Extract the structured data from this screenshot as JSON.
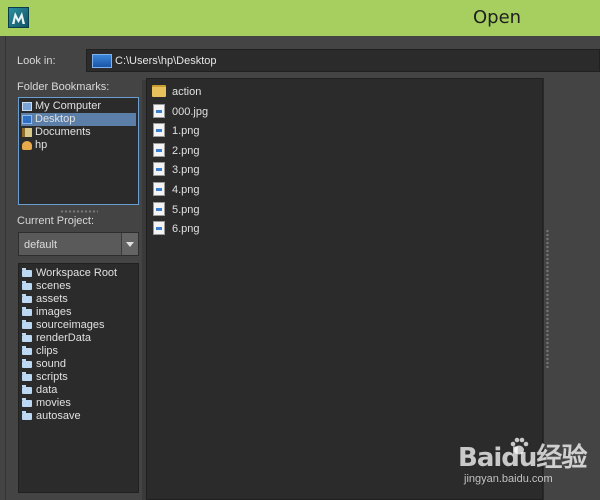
{
  "window": {
    "title": "Open",
    "titlebar_color": "#a6cf5f"
  },
  "look_in": {
    "label": "Look in:",
    "value": "C:\\Users\\hp\\Desktop",
    "icon": "desktop-icon"
  },
  "bookmarks": {
    "label": "Folder Bookmarks:",
    "items": [
      {
        "label": "My Computer",
        "icon": "computer-icon"
      },
      {
        "label": "Desktop",
        "icon": "desktop-icon",
        "selected": true
      },
      {
        "label": "Documents",
        "icon": "documents-icon"
      },
      {
        "label": "hp",
        "icon": "user-icon"
      }
    ]
  },
  "project": {
    "label": "Current Project:",
    "selected": "default",
    "folders": [
      "Workspace Root",
      "scenes",
      "assets",
      "images",
      "sourceimages",
      "renderData",
      "clips",
      "sound",
      "scripts",
      "data",
      "movies",
      "autosave"
    ]
  },
  "files": [
    {
      "name": "action",
      "type": "folder",
      "icon": "folder-icon"
    },
    {
      "name": "000.jpg",
      "type": "image",
      "icon": "image-file-icon"
    },
    {
      "name": "1.png",
      "type": "image",
      "icon": "image-file-icon"
    },
    {
      "name": "2.png",
      "type": "image",
      "icon": "image-file-icon"
    },
    {
      "name": "3.png",
      "type": "image",
      "icon": "image-file-icon"
    },
    {
      "name": "4.png",
      "type": "image",
      "icon": "image-file-icon"
    },
    {
      "name": "5.png",
      "type": "image",
      "icon": "image-file-icon"
    },
    {
      "name": "6.png",
      "type": "image",
      "icon": "image-file-icon"
    }
  ],
  "watermark": {
    "main": "Baidu经验",
    "sub": "jingyan.baidu.com"
  }
}
